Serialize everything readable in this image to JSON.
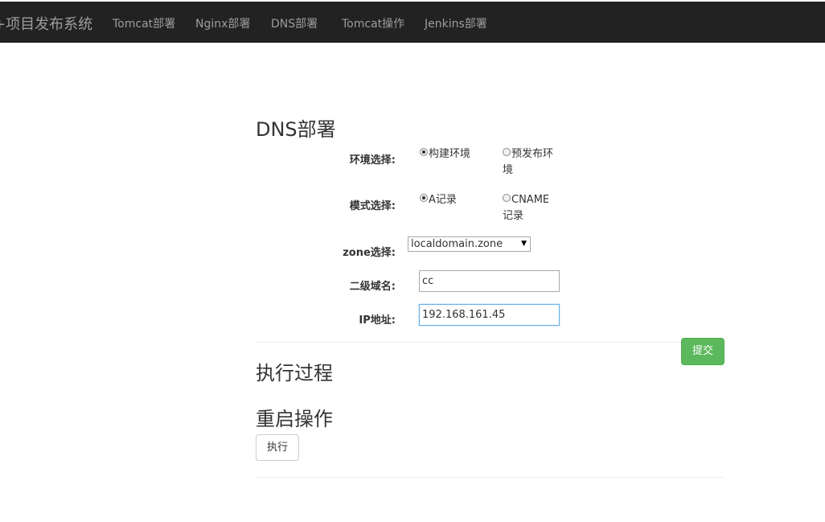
{
  "navbar": {
    "brand": "+项目发布系统",
    "items": [
      "Tomcat部署",
      "Nginx部署",
      "DNS部署",
      "Tomcat操作",
      "Jenkins部署"
    ]
  },
  "page_title": "DNS部署",
  "form": {
    "env_label": "环境选择:",
    "env_options": {
      "build": "构建环境",
      "prerelease_line1": "预发布环",
      "prerelease_line2": "境"
    },
    "env_selected": "构建环境",
    "mode_label": "模式选择:",
    "mode_options": {
      "a_record": "A记录",
      "cname_line1": "CNAME",
      "cname_line2": "记录"
    },
    "mode_selected": "A记录",
    "zone_label": "zone选择:",
    "zone_value": "localdomain.zone",
    "subdomain_label": "二级域名:",
    "subdomain_value": "cc",
    "ip_label": "IP地址:",
    "ip_value": "192.168.161.45",
    "submit_label": "提交"
  },
  "sections": {
    "process_title": "执行过程",
    "restart_title": "重启操作",
    "exec_label": "执行"
  },
  "colors": {
    "navbar_bg": "#222222",
    "submit_bg": "#5cb85c",
    "focus_border": "#66afe9"
  }
}
